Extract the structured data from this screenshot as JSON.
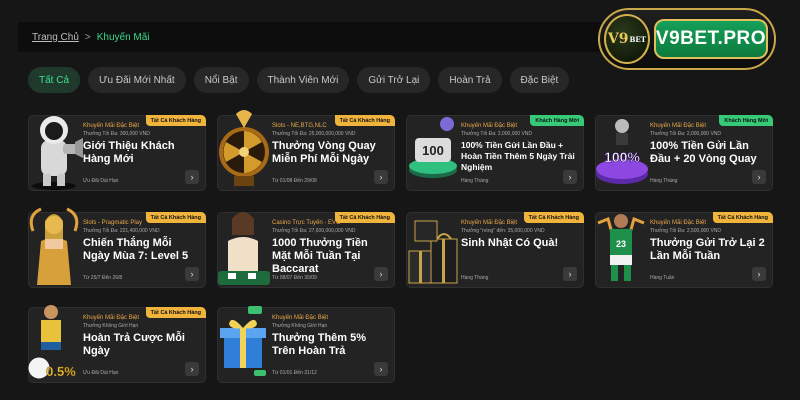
{
  "breadcrumb": {
    "home": "Trang Chủ",
    "separator": ">",
    "current": "Khuyến Mãi"
  },
  "logo": {
    "badge": "V9",
    "badge_small": "BET",
    "text": "V9BET.PRO"
  },
  "tabs": [
    "Tất Cả",
    "Ưu Đãi Mới Nhất",
    "Nổi Bật",
    "Thành Viên Mới",
    "Gửi Trở Lại",
    "Hoàn Trả",
    "Đặc Biệt"
  ],
  "cards": [
    {
      "ribbon": "Tất Cả Khách Hàng",
      "ribbon_color": "gold",
      "category": "Khuyến Mãi Đặc Biệt",
      "sub": "Thưởng Tối Đa: 300,000 VND",
      "title": "Giới Thiệu Khách Hàng Mới",
      "meta": "Ưu Đãi Dài Hạn",
      "art": "astronaut"
    },
    {
      "ribbon": "Tất Cả Khách Hàng",
      "ribbon_color": "gold",
      "category": "Slots - NE,BTG,NLC",
      "sub": "Thưởng Tối Đa: 25,000,000,000 VND",
      "title": "Thưởng Vòng Quay Miễn Phí Mỗi Ngày",
      "meta": "Từ 01/08 Đến 29/08",
      "art": "wheel"
    },
    {
      "ribbon": "Khách Hàng Mới",
      "ribbon_color": "green",
      "category": "Khuyến Mãi Đặc Biệt",
      "sub": "Thưởng Tối Đa: 2,000,000 VND",
      "title": "100% Tiền Gửi Lần Đầu + Hoàn Tiền Thêm 5 Ngày Trải Nghiệm",
      "meta": "Hàng Tháng",
      "art": "hundred"
    },
    {
      "ribbon": "Khách Hàng Mới",
      "ribbon_color": "green",
      "category": "Khuyến Mãi Đặc Biệt",
      "sub": "Thưởng Tối Đa: 2,000,000 VND",
      "title": "100% Tiền Gửi Lần Đầu + 20 Vòng Quay",
      "meta": "Hàng Tháng",
      "art": "hundred-purple"
    },
    {
      "ribbon": "Tất Cả Khách Hàng",
      "ribbon_color": "gold",
      "category": "Slots - Pragmatic Play",
      "sub": "Thưởng Tối Đa: 221,400,000 VND",
      "title": "Chiến Thắng Mỗi Ngày Mùa 7: Level 5",
      "meta": "Từ 25/7 Đến 26/8",
      "art": "goddess"
    },
    {
      "ribbon": "Tất Cả Khách Hàng",
      "ribbon_color": "gold",
      "category": "Casino Trực Tuyến - EVO",
      "sub": "Thưởng Tối Đa: 27,600,000,000 VND",
      "title": "1000 Thưởng Tiền Mặt Mỗi Tuần Tại Baccarat",
      "meta": "Từ 08/07 Đến 30/09",
      "art": "dealer"
    },
    {
      "ribbon": "Tất Cả Khách Hàng",
      "ribbon_color": "gold",
      "category": "Khuyến Mãi Đặc Biệt",
      "sub": "Thưởng \"nóng\" đến: 35,000,000 VND",
      "title": "Sinh Nhật Có Quà!",
      "meta": "Hàng Tháng",
      "art": "gifts"
    },
    {
      "ribbon": "Tất Cả Khách Hàng",
      "ribbon_color": "gold",
      "category": "Khuyến Mãi Đặc Biệt",
      "sub": "Thưởng Tối Đa: 2,500,000 VND",
      "title": "Thưởng Gửi Trở Lại 2 Lần Mỗi Tuần",
      "meta": "Hàng Tuần",
      "art": "player"
    },
    {
      "ribbon": "Tất Cả Khách Hàng",
      "ribbon_color": "gold",
      "category": "Khuyến Mãi Đặc Biệt",
      "sub": "Thưởng Không Giới Hạn",
      "title": "Hoàn Trả Cược Mỗi Ngày",
      "meta": "Ưu Đãi Dài Hạn",
      "art": "soccer"
    },
    {
      "ribbon": "",
      "ribbon_color": "",
      "category": "Khuyến Mãi Đặc Biệt",
      "sub": "Thưởng Không Giới Hạn",
      "title": "Thưởng Thêm 5% Trên Hoàn Trả",
      "meta": "Từ 01/01 Đến 31/12",
      "art": "giftbox"
    }
  ]
}
